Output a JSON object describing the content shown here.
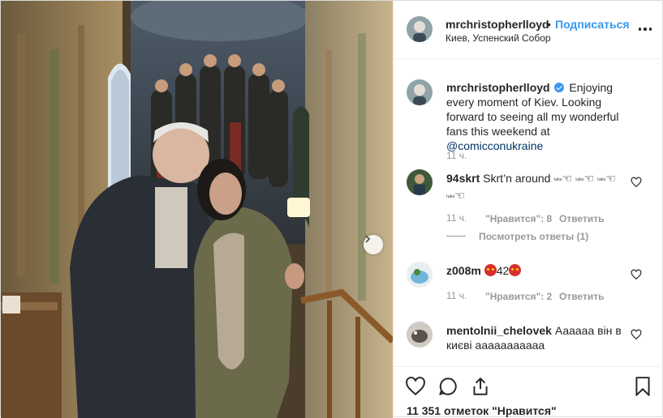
{
  "post": {
    "username": "mrchristopherlloyd",
    "separator": "•",
    "follow_label": "Подписаться",
    "location": "Киев, Успенский Собор",
    "more_icon": "more-horizontal-icon"
  },
  "caption": {
    "username": "mrchristopherlloyd",
    "text": "Enjoying every moment of Kiev. Looking forward to seeing all my wonderful fans this weekend at ",
    "mention": "@comicconukraine",
    "time": "11 ч."
  },
  "comments": [
    {
      "username": "94skrt",
      "text": "Skrt’n around",
      "emoji_text": "ᵗᵃᵏᵉ",
      "time": "11 ч.",
      "likes": "\"Нравится\": 8",
      "reply_label": "Ответить",
      "view_replies": "Посмотреть ответы (1)"
    },
    {
      "username": "z008m",
      "number": "42",
      "time": "11 ч.",
      "likes": "\"Нравится\": 2",
      "reply_label": "Ответить"
    },
    {
      "username": "mentolnii_chelovek",
      "text": "Аааааа він в києві ааааааааааа"
    }
  ],
  "actions": {
    "like_icon": "heart-icon",
    "comment_icon": "comment-icon",
    "share_icon": "share-icon",
    "save_icon": "bookmark-icon",
    "likes_count": "11 351 отметок \"Нравится\""
  },
  "colors": {
    "link": "#3897f0",
    "muted": "#999999",
    "text": "#262626"
  }
}
